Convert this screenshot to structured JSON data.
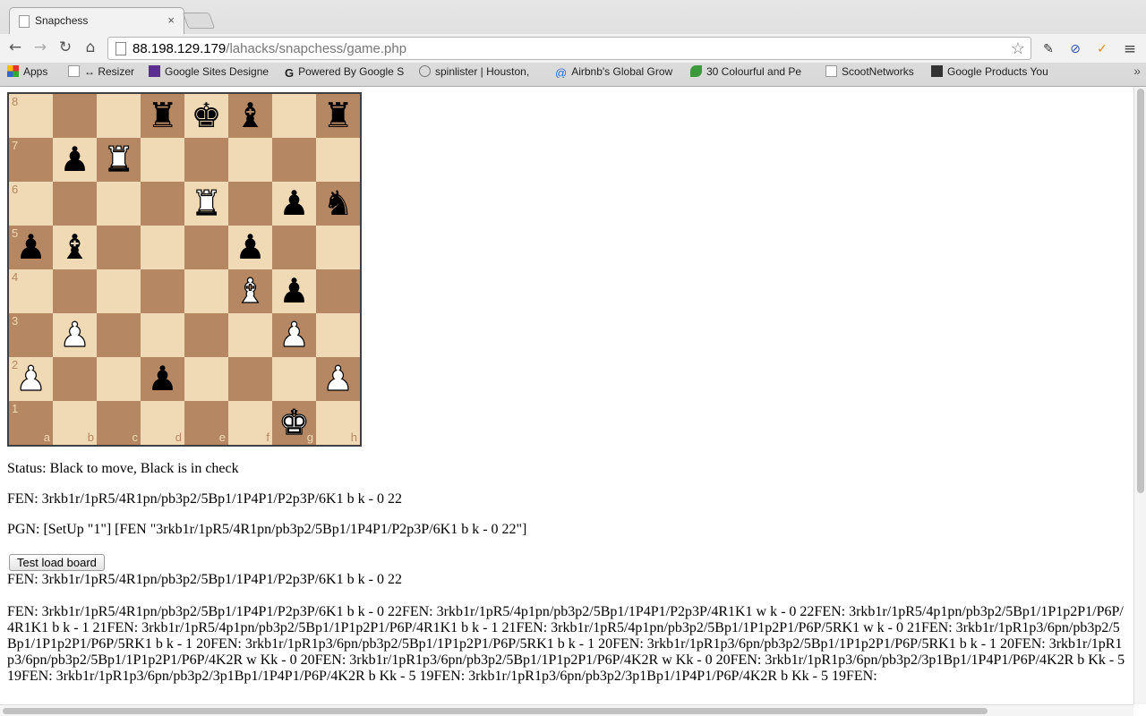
{
  "browser": {
    "tab_title": "Snapchess",
    "tab_close": "×",
    "url_host": "88.198.129.179",
    "url_path": "/lahacks/snapchess/game.php",
    "bookmarks": [
      "Apps",
      "↔ Resizer",
      "Google Sites Designe",
      "Powered By Google S",
      "spinlister | Houston,",
      "Airbnb's Global Grow",
      "30 Colourful and Pe",
      "ScootNetworks",
      "Google Products You"
    ],
    "bookmarks_overflow": "»",
    "icons": {
      "back": "arrow-left-icon",
      "forward": "arrow-right-icon",
      "reload": "reload-icon",
      "home": "home-icon",
      "star": "star-icon",
      "menu": "hamburger-menu-icon"
    }
  },
  "board": {
    "rank_labels": [
      "8",
      "7",
      "6",
      "5",
      "4",
      "3",
      "2",
      "1"
    ],
    "file_labels": [
      "a",
      "b",
      "c",
      "d",
      "e",
      "f",
      "g",
      "h"
    ],
    "light_color": "#f0d9b5",
    "dark_color": "#b58863",
    "position": [
      "...rkb.r",
      ".pR.....",
      "....R.pn",
      "pb...p..",
      ".....Bp.",
      ".P....P.",
      "P..p...P",
      "......K."
    ]
  },
  "status": "Status: Black to move, Black is in check",
  "fen": "FEN: 3rkb1r/1pR5/4R1pn/pb3p2/5Bp1/1P4P1/P2p3P/6K1 b k - 0 22",
  "pgn": "PGN: [SetUp \"1\"] [FEN \"3rkb1r/1pR5/4R1pn/pb3p2/5Bp1/1P4P1/P2p3P/6K1 b k - 0 22\"]",
  "test_button_label": "Test load board",
  "fen_after_button": "FEN: 3rkb1r/1pR5/4R1pn/pb3p2/5Bp1/1P4P1/P2p3P/6K1 b k - 0 22",
  "history": "FEN: 3rkb1r/1pR5/4R1pn/pb3p2/5Bp1/1P4P1/P2p3P/6K1 b k - 0 22FEN: 3rkb1r/1pR5/4p1pn/pb3p2/5Bp1/1P4P1/P2p3P/4R1K1 w k - 0 22FEN: 3rkb1r/1pR5/4p1pn/pb3p2/5Bp1/1P1p2P1/P6P/4R1K1 b k - 1 21FEN: 3rkb1r/1pR5/4p1pn/pb3p2/5Bp1/1P1p2P1/P6P/4R1K1 b k - 1 21FEN: 3rkb1r/1pR5/4p1pn/pb3p2/5Bp1/1P1p2P1/P6P/5RK1 w k - 0 21FEN: 3rkb1r/1pR1p3/6pn/pb3p2/5Bp1/1P1p2P1/P6P/5RK1 b k - 1 20FEN: 3rkb1r/1pR1p3/6pn/pb3p2/5Bp1/1P1p2P1/P6P/5RK1 b k - 1 20FEN: 3rkb1r/1pR1p3/6pn/pb3p2/5Bp1/1P1p2P1/P6P/5RK1 b k - 1 20FEN: 3rkb1r/1pR1p3/6pn/pb3p2/5Bp1/1P1p2P1/P6P/4K2R w Kk - 0 20FEN: 3rkb1r/1pR1p3/6pn/pb3p2/5Bp1/1P1p2P1/P6P/4K2R w Kk - 0 20FEN: 3rkb1r/1pR1p3/6pn/pb3p2/3p1Bp1/1P4P1/P6P/4K2R b Kk - 5 19FEN: 3rkb1r/1pR1p3/6pn/pb3p2/3p1Bp1/1P4P1/P6P/4K2R b Kk - 5 19FEN: 3rkb1r/1pR1p3/6pn/pb3p2/3p1Bp1/1P4P1/P6P/4K2R b Kk - 5 19FEN:"
}
